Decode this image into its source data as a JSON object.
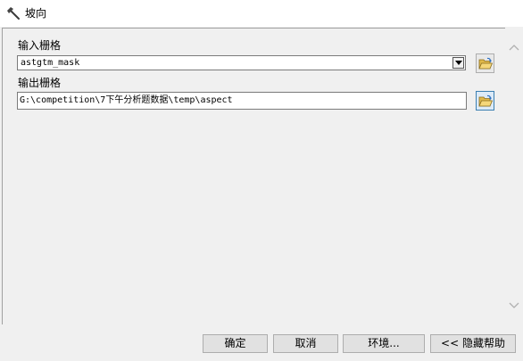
{
  "window": {
    "title": "坡向",
    "icon": "hammer-icon"
  },
  "form": {
    "input_label": "输入栅格",
    "input_value": "astgtm_mask",
    "output_label": "输出栅格",
    "output_value": "G:\\competition\\7下午分析题数据\\temp\\aspect"
  },
  "buttons": {
    "ok": "确定",
    "cancel": "取消",
    "environments": "环境...",
    "hide_help": "<< 隐藏帮助"
  },
  "icons": {
    "browse": "open-folder-icon",
    "dropdown": "chevron-down-icon",
    "scroll_up": "chevron-up-icon",
    "scroll_down": "chevron-down-icon"
  }
}
